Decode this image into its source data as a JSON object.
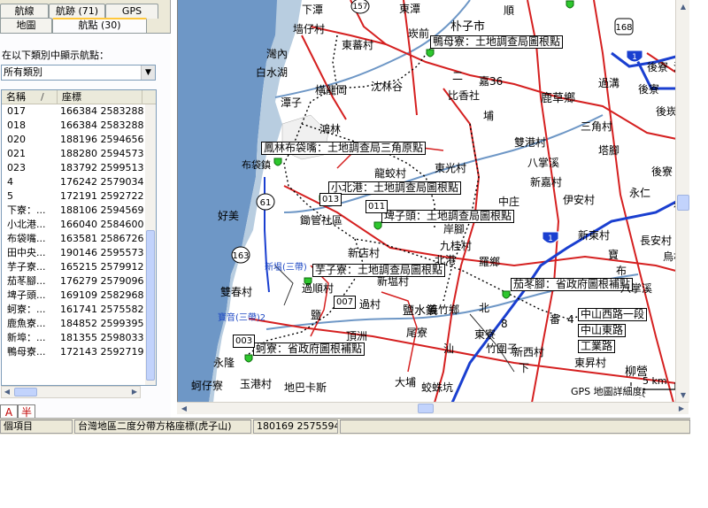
{
  "tabs": {
    "top": [
      "航線",
      "航跡 (71)",
      "GPS"
    ],
    "bottom": [
      "地圖",
      "航點 (30)"
    ]
  },
  "category": {
    "label": "在以下類別中顯示航點：",
    "selected": "所有類別"
  },
  "list": {
    "col_name": "名稱",
    "col_coord": "座標",
    "rows": [
      {
        "name": "017",
        "coord": "166384 2583288"
      },
      {
        "name": "018",
        "coord": "166384 2583288"
      },
      {
        "name": "020",
        "coord": "188196 2594656"
      },
      {
        "name": "021",
        "coord": "188280 2594573"
      },
      {
        "name": "023",
        "coord": "183792 2599513"
      },
      {
        "name": "4",
        "coord": "176242 2579034"
      },
      {
        "name": "5",
        "coord": "172191 2592722"
      },
      {
        "name": "下寮：...",
        "coord": "188106 2594569"
      },
      {
        "name": "小北港...",
        "coord": "166040 2584600"
      },
      {
        "name": "布袋嘴...",
        "coord": "163581 2586726"
      },
      {
        "name": "田中央...",
        "coord": "190146 2595573"
      },
      {
        "name": "芋子寮...",
        "coord": "165215 2579912"
      },
      {
        "name": "茄苳腳...",
        "coord": "176279 2579096"
      },
      {
        "name": "埤子頭...",
        "coord": "169109 2582968"
      },
      {
        "name": "蚵寮：...",
        "coord": "161741 2575582"
      },
      {
        "name": "鹿魚寮...",
        "coord": "184852 2599395"
      },
      {
        "name": "新埠：...",
        "coord": "181355 2598033"
      },
      {
        "name": "鴨母寮...",
        "coord": "172143 2592719"
      }
    ]
  },
  "ime": [
    "A",
    "半"
  ],
  "status": {
    "items": "個項目",
    "coord_system": "台灣地區二度分帶方格座標(虎子山)",
    "cursor": "180169 2575594"
  },
  "map": {
    "waypoint_labels": [
      "鴨母寮：土地調查局圖根點",
      "鳳林布袋嘴：土地調查局三角原點",
      "小北港：土地調查局圖根點",
      "埤子頭：土地調查局圖根點",
      "芋子寮：土地調查局圖根點",
      "茄苳腳：省政府圖根補點",
      "蚵寮：省政府圖根補點",
      "中山西路一段",
      "中山東路",
      "工業路"
    ],
    "waypoint_codes": [
      "013",
      "011",
      "007",
      "003"
    ],
    "place_labels": [
      "墙仔村",
      "下潭",
      "東潭",
      "東蕃村",
      "崁前",
      "朴子市",
      "順",
      "灣內",
      "白水湖",
      "嘉36",
      "二",
      "後寮",
      "潭子",
      "沈林谷",
      "横龍岡",
      "比香社",
      "鹿草鄉",
      "後崁",
      "過溝",
      "港",
      "後寮",
      "埔",
      "鴻林",
      "三角村",
      "布袋鎮",
      "龍蛟村",
      "東光村",
      "雙港村",
      "塔腳",
      "八掌溪",
      "後寮",
      "新嘉村",
      "中庄",
      "好美",
      "鋤管社區",
      "伊安村",
      "永仁",
      "岸腳",
      "新東村",
      "九桂村",
      "羅鄉",
      "長安村",
      "新店村",
      "寶",
      "烏村",
      "新塭村",
      "布",
      "雙春村",
      "過順村",
      "八掌溪",
      "過村",
      "義竹鄉",
      "鹽水鎮",
      "北",
      "鹽",
      "頂洲",
      "尾寮",
      "東寮",
      "汕",
      "永隆",
      "新西村",
      "柳營",
      "竹圍子",
      "大埔",
      "蛟蛛坑",
      "地巴卡斯",
      "玉港村",
      "蚵仔寮",
      "東昇村",
      "北港",
      "大寮",
      "4",
      "8",
      "鹽東",
      "番",
      "下",
      "後",
      "山",
      "坡"
    ],
    "road_labels": [
      "新塭(三帶)",
      "寶音(三帶)2"
    ],
    "shield_numbers": [
      "168",
      "1",
      "61",
      "163",
      "1",
      "157"
    ],
    "scale_label": "5 km",
    "detail_label": "GPS 地圖詳細度"
  }
}
